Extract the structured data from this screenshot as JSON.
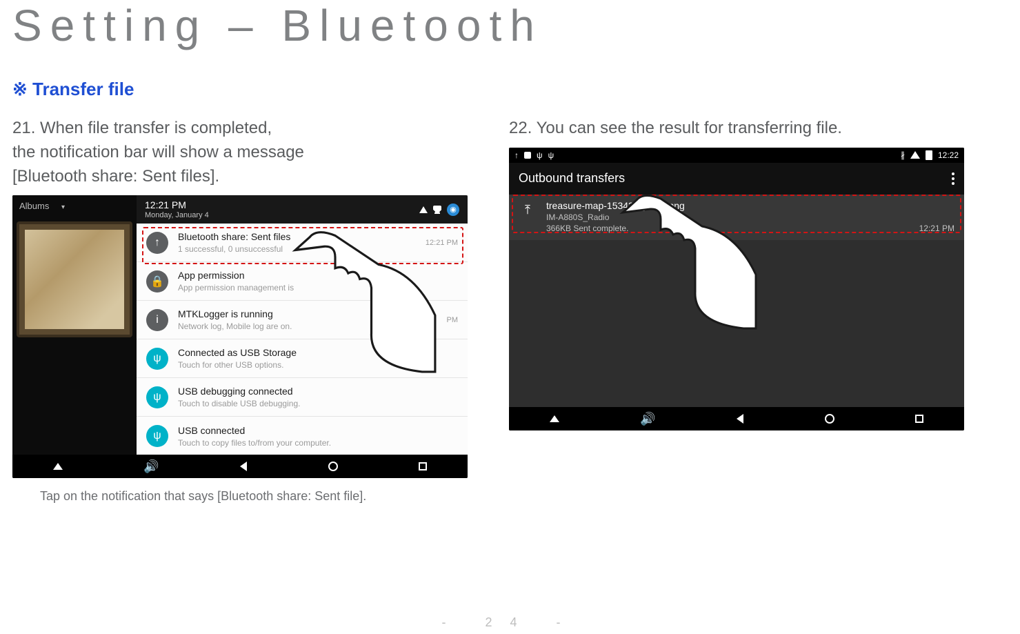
{
  "page": {
    "title": "Setting – Bluetooth",
    "section": "※ Transfer file",
    "footer_number": "-   24   -"
  },
  "step21": {
    "heading": "21. When file transfer is completed,\n      the notification bar will show a message\n      [Bluetooth share: Sent files].",
    "caption": "Tap on the notification that says [Bluetooth share: Sent file].",
    "albums_label": "Albums",
    "shade_time": "12:21 PM",
    "shade_date": "Monday, January 4",
    "notifications": [
      {
        "title": "Bluetooth share: Sent files",
        "sub": "1 successful, 0 unsuccessful",
        "time": "12:21 PM",
        "icon": "upload-icon"
      },
      {
        "title": "App permission",
        "sub": "App permission management is",
        "time": "",
        "icon": "lock-icon"
      },
      {
        "title": "MTKLogger is running",
        "sub": "Network log, Mobile log are on.",
        "time": "PM",
        "icon": "info-icon"
      },
      {
        "title": "Connected as USB Storage",
        "sub": "Touch for other USB options.",
        "time": "",
        "icon": "usb-icon"
      },
      {
        "title": "USB debugging connected",
        "sub": "Touch to disable USB debugging.",
        "time": "",
        "icon": "usb-icon"
      },
      {
        "title": "USB connected",
        "sub": "Touch to copy files to/from your computer.",
        "time": "",
        "icon": "usb-icon"
      }
    ]
  },
  "step22": {
    "heading": "22. You can see the result for transferring file.",
    "status_time": "12:22",
    "title_bar": "Outbound transfers",
    "row": {
      "filename": "treasure-map-153425_1280.png",
      "device": "IM-A880S_Radio",
      "status": "366KB Sent complete.",
      "time": "12:21 PM"
    }
  }
}
